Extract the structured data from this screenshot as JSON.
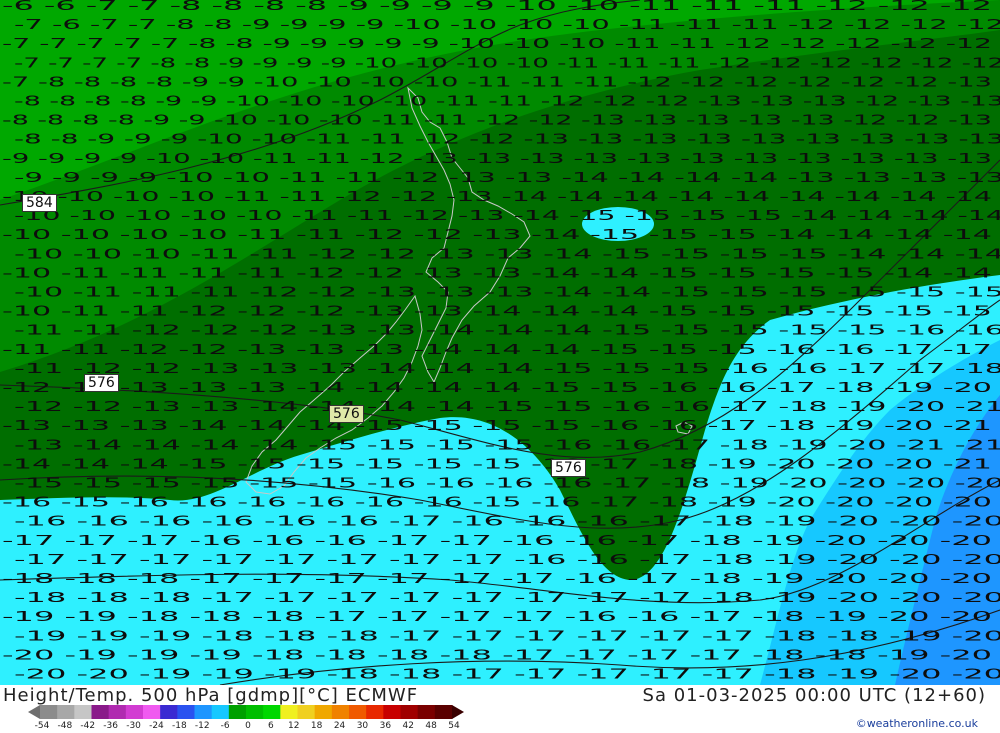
{
  "map": {
    "contour_labels": [
      "584",
      "576",
      "576",
      "576"
    ],
    "temperature_numbers": {
      "row_00": "-6 -6 -7 -7 -8 -8 -8 -8 -9 -9 -9 -9 -10 -10 -11 -11 -11 -12 -12 -12",
      "row_01": "-7 -6 -7 -7 -8 -8 -9 -9 -9 -9 -10 -10 -10 -10 -11 -11 -11 -12 -12 -12 -12",
      "row_02": "-7 -7 -7 -7 -7 -8 -8 -9 -9 -9 -9 -9 -10 -10 -10 -11 -11 -12 -12 -12 -12 -12",
      "row_03": "-7 -7 -7 -7 -8 -8 -9 -9 -9 -9 -10 -10 -10 -10 -11 -11 -11 -12 -12 -12 -12 -12 -12",
      "row_04": "-7 -8 -8 -8 -8 -9 -9 -10 -10 -10 -10 -11 -11 -11 -12 -12 -12 -12 -12 -12 -13",
      "row_05": "-8 -8 -8 -8 -9 -9 -10 -10 -10 -10 -11 -11 -12 -12 -12 -13 -13 -13 -12 -13 -13",
      "row_06": "-8 -8 -8 -8 -9 -9 -10 -10 -10 -11 -11 -12 -12 -13 -13 -13 -13 -13 -12 -12 -13",
      "row_07": "-8 -8 -9 -9 -9 -10 -10 -11 -11 -12 -12 -13 -13 -13 -13 -13 -13 -13 -13 -13",
      "row_08": "-9 -9 -9 -9 -10 -10 -11 -11 -12 -13 -13 -13 -13 -13 -13 -13 -13 -13 -13 -13",
      "row_09": "-9 -9 -9 -9 -10 -10 -11 -11 -12 -13 -13 -14 -14 -14 -14 -13 -13 -13 -13",
      "row_10": "-10 -10 -10 -10 -11 -11 -12 -12 -13 -14 -14 -14 -14 -14 -14 -14 -14 -14",
      "row_11": "-10 -10 -10 -10 -10 -11 -11 -12 -13 -14 -15 -15 -15 -15 -14 -14 -14 -14",
      "row_12": "-10 -10 -10 -10 -11 -11 -12 -12 -13 -14 -15 -15 -15 -14 -14 -14 -14",
      "row_13": "-10 -10 -10 -11 -11 -12 -12 -13 -13 -14 -15 -15 -15 -15 -14 -14 -14",
      "row_14": "-10 -11 -11 -11 -11 -12 -12 -13 -13 -14 -14 -15 -15 -15 -15 -14 -14",
      "row_15": "-10 -11 -11 -11 -12 -12 -13 -13 -13 -14 -14 -15 -15 -15 -15 -15 -15",
      "row_16": "-10 -11 -11 -12 -12 -12 -13 -13 -14 -14 -14 -15 -15 -15 -15 -15 -15",
      "row_17": "-11 -11 -12 -12 -12 -13 -13 -14 -14 -14 -15 -15 -15 -15 -15 -16 -16",
      "row_18": "-11 -11 -12 -12 -13 -13 -13 -14 -14 -14 -15 -15 -15 -16 -16 -17 -17",
      "row_19": "-11 -12 -12 -13 -13 -13 -14 -14 -14 -15 -15 -15 -16 -16 -17 -17 -18",
      "row_20": "-12 -12 -13 -13 -13 -14 -14 -14 -14 -15 -15 -16 -16 -17 -18 -19 -20",
      "row_21": "-12 -12 -13 -13 -14 -14 -14 -14 -15 -15 -16 -16 -17 -18 -19 -20 -21",
      "row_22": "-13 -13 -13 -14 -14 -14 -15 -15 -15 -15 -16 -16 -17 -18 -19 -20 -21",
      "row_23": "-13 -14 -14 -14 -14 -15 -15 -15 -15 -16 -16 -17 -18 -19 -20 -21 -21",
      "row_24": "-14 -14 -14 -15 -15 -15 -15 -15 -15 -16 -17 -18 -19 -20 -20 -20 -21",
      "row_25": "-15 -15 -15 -15 -15 -15 -16 -16 -16 -16 -17 -18 -19 -20 -20 -20 -20",
      "row_26": "-16 -15 -16 -16 -16 -16 -16 -16 -15 -16 -17 -18 -19 -20 -20 -20 -20",
      "row_27": "-16 -16 -16 -16 -16 -16 -17 -16 -16 -16 -17 -18 -19 -20 -20 -20",
      "row_28": "-17 -17 -17 -16 -16 -16 -17 -17 -16 -16 -17 -18 -19 -20 -20 -20",
      "row_29": "-17 -17 -17 -17 -17 -17 -17 -17 -16 -16 -17 -18 -19 -20 -20 -20",
      "row_30": "-18 -18 -18 -17 -17 -17 -17 -17 -17 -16 -17 -18 -19 -20 -20 -20",
      "row_31": "-18 -18 -18 -17 -17 -17 -17 -17 -17 -17 -17 -18 -19 -20 -20 -20",
      "row_32": "-19 -19 -18 -18 -18 -17 -17 -17 -17 -16 -16 -17 -18 -19 -20 -20",
      "row_33": "-19 -19 -19 -18 -18 -18 -17 -17 -17 -17 -17 -17 -18 -18 -19 -20",
      "row_34": "-20 -19 -19 -19 -18 -18 -18 -18 -17 -17 -17 -17 -18 -18 -19 -20",
      "row_35": "-20 -20 -19 -19 -19 -18 -18 -17 -17 -17 -17 -17 -18 -19 -20 -20"
    },
    "colors": {
      "green_light": "#00a800",
      "green_mid": "#008a00",
      "green_dark": "#006e00",
      "cyan": "#2ef0ff",
      "sky": "#16c8ff",
      "blue": "#1e96ff",
      "contour": "#1b1b1b",
      "text": "#0d0d0d",
      "coast": "#c8c8c8"
    }
  },
  "footer": {
    "title": "Height/Temp. 500 hPa [gdmp][°C] ECMWF",
    "datetime": "Sa 01-03-2025 00:00 UTC (12+60)",
    "credit": "©weatheronline.co.uk"
  },
  "scale": {
    "labels": [
      "-54",
      "-48",
      "-42",
      "-36",
      "-30",
      "-24",
      "-18",
      "-12",
      "-6",
      "0",
      "6",
      "12",
      "18",
      "24",
      "30",
      "36",
      "42",
      "48",
      "54"
    ],
    "colors": [
      "#8c8c8c",
      "#a8a8a8",
      "#c6c6c6",
      "#8a1a8a",
      "#b02ab0",
      "#d23cd2",
      "#f05af0",
      "#3a2ad2",
      "#2a52f0",
      "#1e96ff",
      "#16c8ff",
      "#00a000",
      "#00be00",
      "#00d800",
      "#f0f020",
      "#f0d020",
      "#f0a800",
      "#f08200",
      "#f05a00",
      "#e82800",
      "#c80000",
      "#a00000",
      "#7a0000",
      "#5a0000"
    ]
  }
}
